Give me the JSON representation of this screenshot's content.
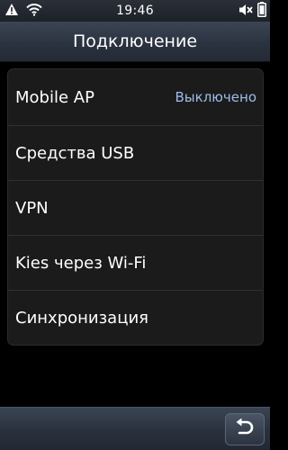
{
  "status_bar": {
    "time": "19:46",
    "icons": [
      "warning-icon",
      "wifi-icon",
      "mute-icon",
      "battery-icon"
    ]
  },
  "header": {
    "title": "Подключение"
  },
  "settings": {
    "items": [
      {
        "label": "Mobile AP",
        "value": "Выключено"
      },
      {
        "label": "Средства USB"
      },
      {
        "label": "VPN"
      },
      {
        "label": "Kies через Wi-Fi"
      },
      {
        "label": "Синхронизация"
      }
    ]
  },
  "bottom_bar": {
    "back_icon": "back-arrow-icon"
  },
  "colors": {
    "background": "#000000",
    "list_background": "#1b1b1c",
    "value_text": "#9dbde8",
    "header_gradient_top": "#3b4554"
  }
}
